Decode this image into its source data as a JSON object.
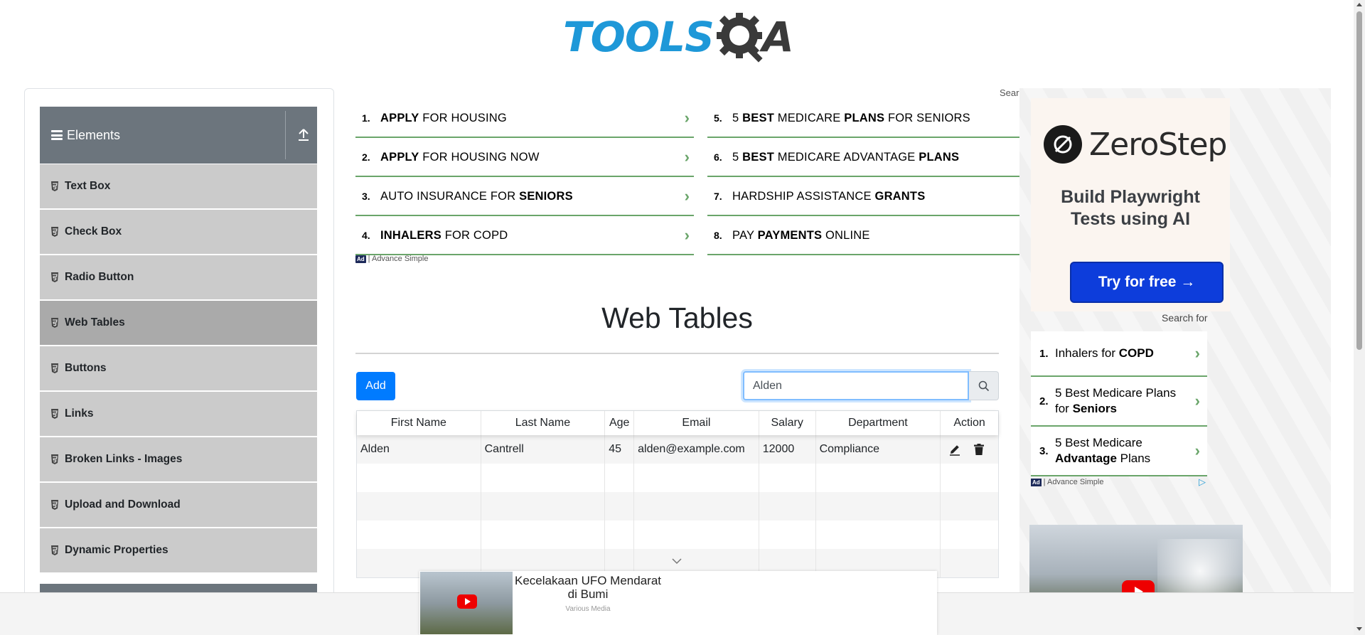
{
  "logo": {
    "part1": "TOOLS",
    "part2": "A"
  },
  "sidebar": {
    "group_title": "Elements",
    "items": [
      {
        "label": "Text Box",
        "active": false
      },
      {
        "label": "Check Box",
        "active": false
      },
      {
        "label": "Radio Button",
        "active": false
      },
      {
        "label": "Web Tables",
        "active": true
      },
      {
        "label": "Buttons",
        "active": false
      },
      {
        "label": "Links",
        "active": false
      },
      {
        "label": "Broken Links - Images",
        "active": false
      },
      {
        "label": "Upload and Download",
        "active": false
      },
      {
        "label": "Dynamic Properties",
        "active": false
      }
    ]
  },
  "ad_keywords": {
    "left": [
      {
        "num": "1.",
        "pre": "",
        "bold": "APPLY",
        "post": " FOR HOUSING"
      },
      {
        "num": "2.",
        "pre": "",
        "bold": "APPLY",
        "post": " FOR HOUSING NOW"
      },
      {
        "num": "3.",
        "pre": "AUTO INSURANCE FOR ",
        "bold": "SENIORS",
        "post": ""
      },
      {
        "num": "4.",
        "pre": "",
        "bold": "INHALERS",
        "post": " FOR COPD"
      }
    ],
    "right": [
      {
        "num": "5.",
        "pre": "5 ",
        "bold": "BEST",
        "post": " MEDICARE ",
        "bold2": "PLANS",
        "post2": " FOR SENIORS"
      },
      {
        "num": "6.",
        "pre": "5 ",
        "bold": "BEST",
        "post": " MEDICARE ADVANTAGE ",
        "bold2": "PLANS",
        "post2": ""
      },
      {
        "num": "7.",
        "pre": "HARDSHIP ASSISTANCE ",
        "bold": "GRANTS",
        "post": ""
      },
      {
        "num": "8.",
        "pre": "PAY ",
        "bold": "PAYMENTS",
        "post": " ONLINE"
      }
    ],
    "badge_ad": "Ad",
    "badge_text": "| Advance Simple",
    "search_label": "Sear"
  },
  "main": {
    "title": "Web Tables",
    "add_label": "Add",
    "search_value": "Alden",
    "table": {
      "columns": [
        "First Name",
        "Last Name",
        "Age",
        "Email",
        "Salary",
        "Department",
        "Action"
      ],
      "rows": [
        {
          "first": "Alden",
          "last": "Cantrell",
          "age": "45",
          "email": "alden@example.com",
          "salary": "12000",
          "department": "Compliance"
        }
      ],
      "empty_rows": 4
    }
  },
  "right_ad": {
    "brand": "ZeroStep",
    "tagline_1": "Build Playwright",
    "tagline_2": "Tests using AI",
    "cta": "Try for free →",
    "search_for": "Search for",
    "items": [
      {
        "num": "1.",
        "pre": "Inhalers for ",
        "bold": "COPD",
        "post": ""
      },
      {
        "num": "2.",
        "pre": "5 Best Medicare Plans for ",
        "bold": "Seniors",
        "post": ""
      },
      {
        "num": "3.",
        "pre": "5 Best Medicare ",
        "bold": "Advantage",
        "post": " Plans"
      }
    ],
    "badge_ad": "Ad",
    "badge_text": "| Advance Simple"
  },
  "sticky_ad": {
    "title": "Kecelakaan UFO Mendarat di Bumi",
    "source": "Various Media"
  },
  "colors": {
    "primary": "#007bff",
    "sidebar_header": "#6c757d",
    "menu_item": "#cbcbcb",
    "menu_active": "#aaaaaa",
    "ad_green": "#6aa56a",
    "logo_blue": "#1e98d8"
  }
}
